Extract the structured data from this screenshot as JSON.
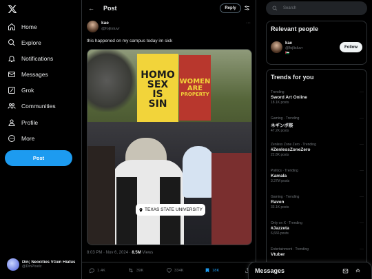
{
  "nav": {
    "items": [
      {
        "label": "Home",
        "icon": "home-icon"
      },
      {
        "label": "Explore",
        "icon": "search-icon"
      },
      {
        "label": "Notifications",
        "icon": "bell-icon"
      },
      {
        "label": "Messages",
        "icon": "mail-icon"
      },
      {
        "label": "Grok",
        "icon": "grok-icon"
      },
      {
        "label": "Communities",
        "icon": "people-icon"
      },
      {
        "label": "Profile",
        "icon": "person-icon"
      },
      {
        "label": "More",
        "icon": "more-circle-icon"
      }
    ],
    "post_button": "Post",
    "account": {
      "name": "Din; Neocities VGen Hiatus",
      "handle": "@DinPixelz"
    }
  },
  "header": {
    "title": "Post",
    "reply_button": "Reply"
  },
  "tweet": {
    "author_name": "kae",
    "author_handle": "@fojlisluvr",
    "text": "this happened on my campus today im sick",
    "image": {
      "sign_left": [
        "HOMO",
        "SEX",
        "IS",
        "SIN"
      ],
      "sign_right": [
        "WOMEN",
        "ARE",
        "PROPERTY"
      ],
      "location_tag": "TEXAS STATE UNIVERSITY"
    },
    "time": "8:03 PM · Nov 6, 2024 ·",
    "views_count": "8.5M",
    "views_label": "Views",
    "actions": {
      "replies": "1.4K",
      "reposts": "39K",
      "likes": "334K",
      "bookmarks": "18K"
    }
  },
  "search": {
    "placeholder": "Search"
  },
  "relevant": {
    "heading": "Relevant people",
    "user": {
      "name": "kae",
      "handle": "@fojlisluvr",
      "follow_label": "Follow"
    }
  },
  "trends": {
    "heading": "Trends for you",
    "items": [
      {
        "context": "Trending",
        "name": "Sword Art Online",
        "count": "18.1K posts"
      },
      {
        "context": "Gaming · Trending",
        "name": "ネギンボ祭",
        "count": "47.2K posts"
      },
      {
        "context": "Zenless Zone Zero · Trending",
        "name": "#ZenlessZoneZero",
        "count": "22.8K posts"
      },
      {
        "context": "Politics · Trending",
        "name": "Kamala",
        "count": "3.37M posts"
      },
      {
        "context": "Gaming · Trending",
        "name": "Raven",
        "count": "33.1K posts"
      },
      {
        "context": "Only on X · Trending",
        "name": "#Jazzeta",
        "count": "6,666 posts"
      },
      {
        "context": "Entertainment · Trending",
        "name": "Vtuber",
        "count": ""
      }
    ]
  },
  "messages": {
    "title": "Messages"
  },
  "colors": {
    "accent": "#1d9bf0",
    "background": "#000000",
    "border": "#2f3336",
    "muted": "#71767b",
    "sign_red": "#b8372d",
    "sign_black": "#1b1b1b",
    "sign_yellow": "#f2d43a"
  }
}
